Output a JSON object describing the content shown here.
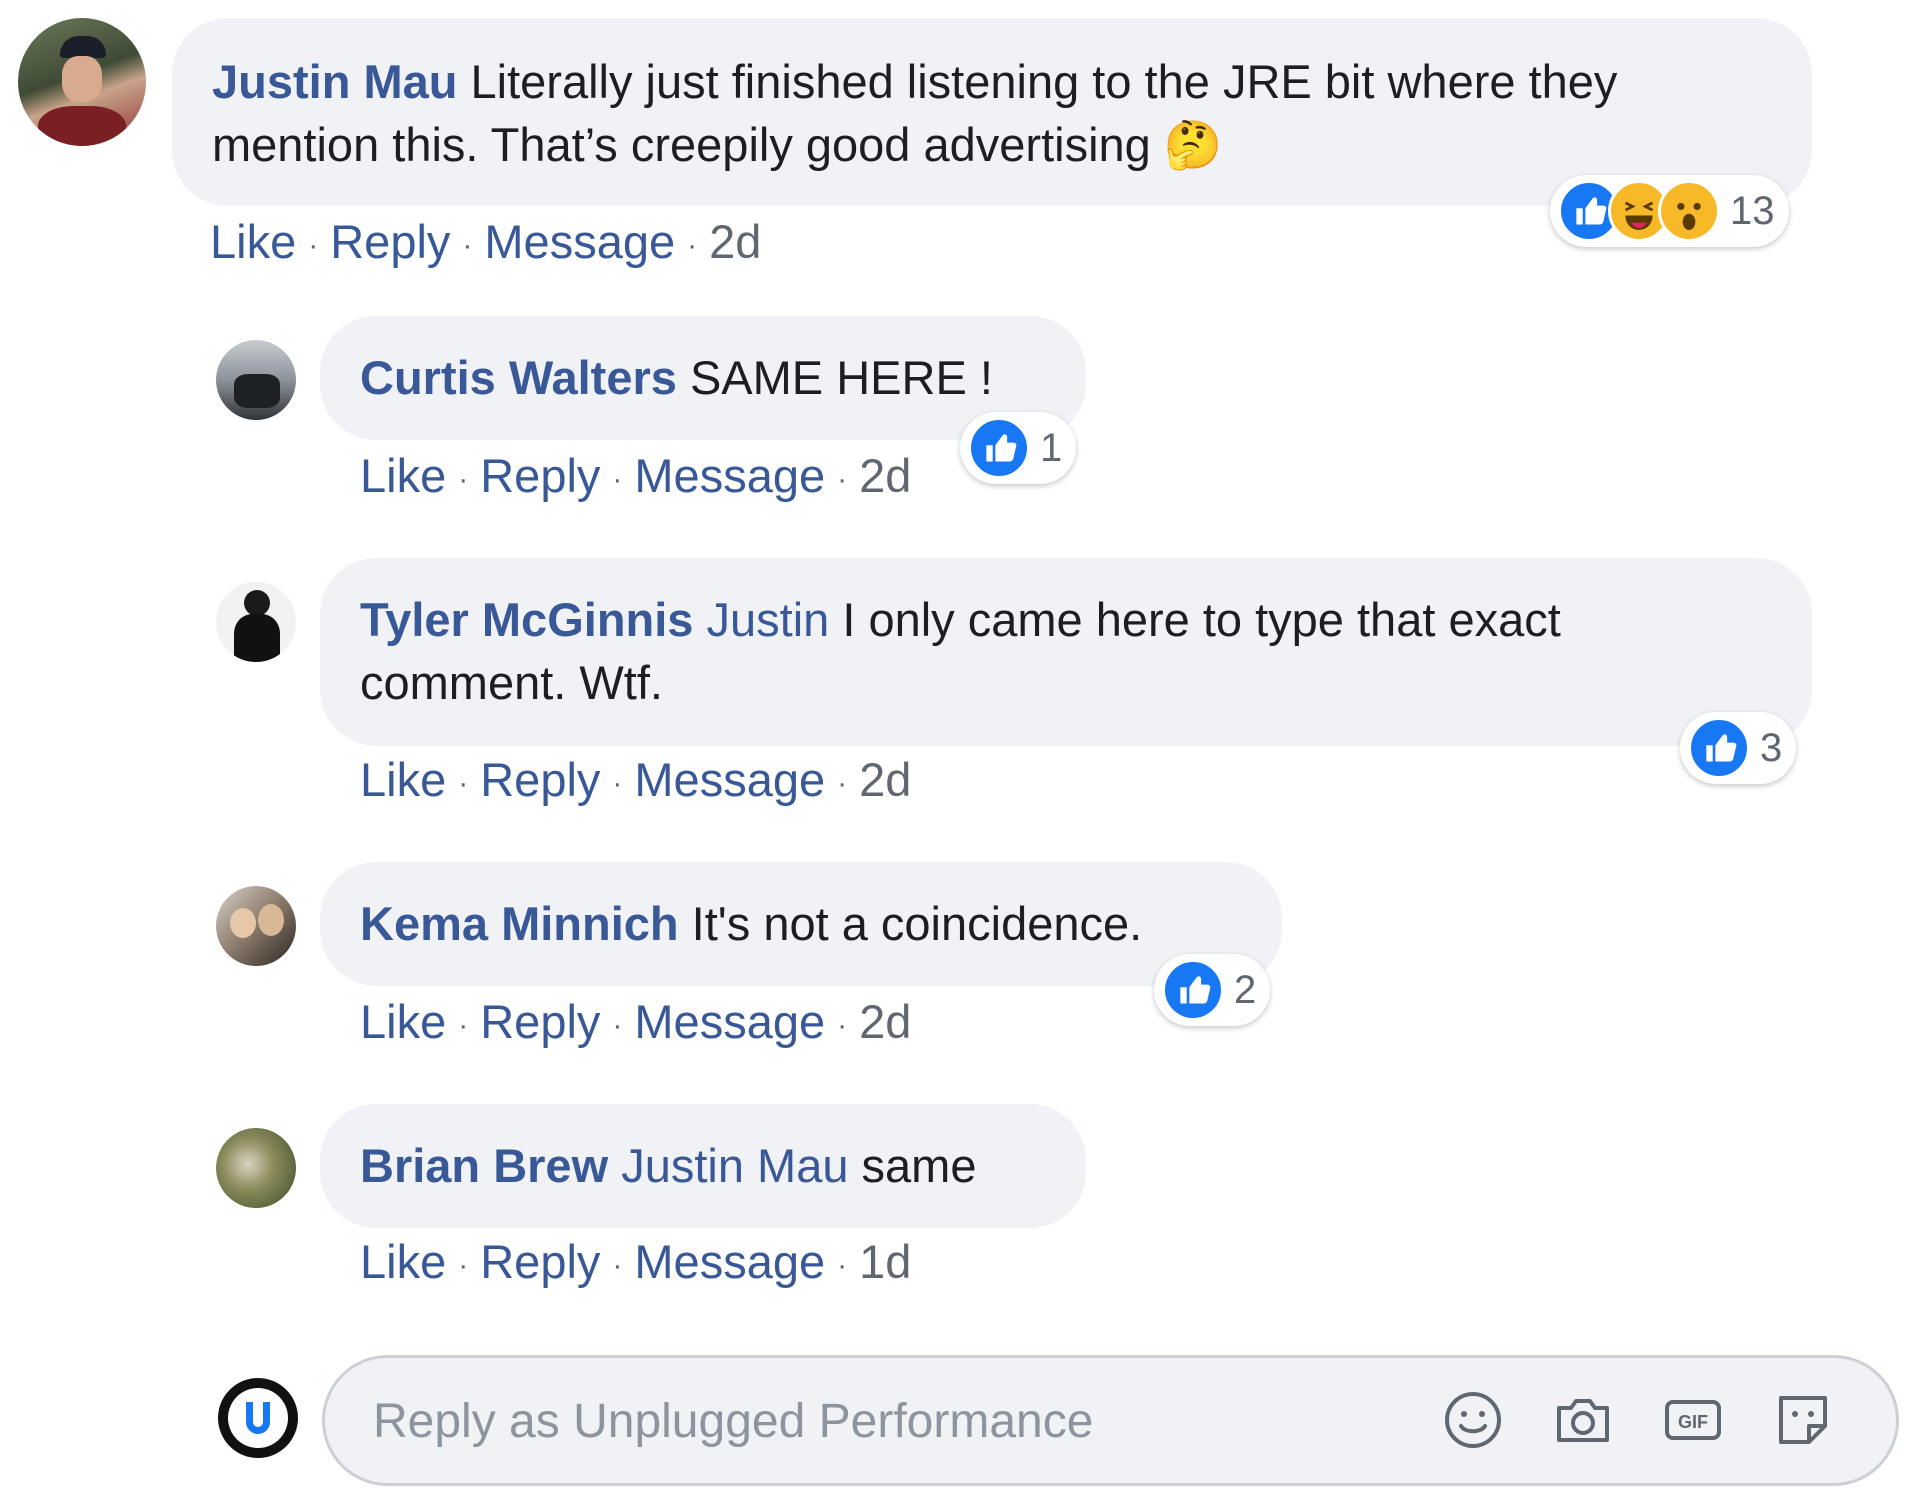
{
  "action_labels": {
    "like": "Like",
    "reply": "Reply",
    "message": "Message",
    "separator": "·"
  },
  "comments": [
    {
      "author": "Justin Mau",
      "mention": "",
      "text": "Literally just finished listening to the JRE bit where they mention this. That’s creepily good advertising 🤔",
      "time": "2d",
      "reactions": [
        "like",
        "haha",
        "wow"
      ],
      "reaction_count": "13"
    },
    {
      "author": "Curtis Walters",
      "mention": "",
      "text": "SAME HERE !",
      "time": "2d",
      "reactions": [
        "like"
      ],
      "reaction_count": "1"
    },
    {
      "author": "Tyler McGinnis",
      "mention": "Justin",
      "text": "I only came here to type that exact comment. Wtf.",
      "time": "2d",
      "reactions": [
        "like"
      ],
      "reaction_count": "3"
    },
    {
      "author": "Kema Minnich",
      "mention": "",
      "text": "It's not a coincidence.",
      "time": "2d",
      "reactions": [
        "like"
      ],
      "reaction_count": "2"
    },
    {
      "author": "Brian Brew",
      "mention": "Justin Mau",
      "text": "same",
      "time": "1d",
      "reactions": [],
      "reaction_count": ""
    }
  ],
  "reply_box": {
    "placeholder": "Reply as Unplugged Performance",
    "tools": [
      "emoji-icon",
      "camera-icon",
      "gif-icon",
      "sticker-icon"
    ]
  },
  "colors": {
    "link": "#385898",
    "bubble": "#f0f2f5",
    "like": "#1877f2",
    "brand": "#1877f2"
  }
}
